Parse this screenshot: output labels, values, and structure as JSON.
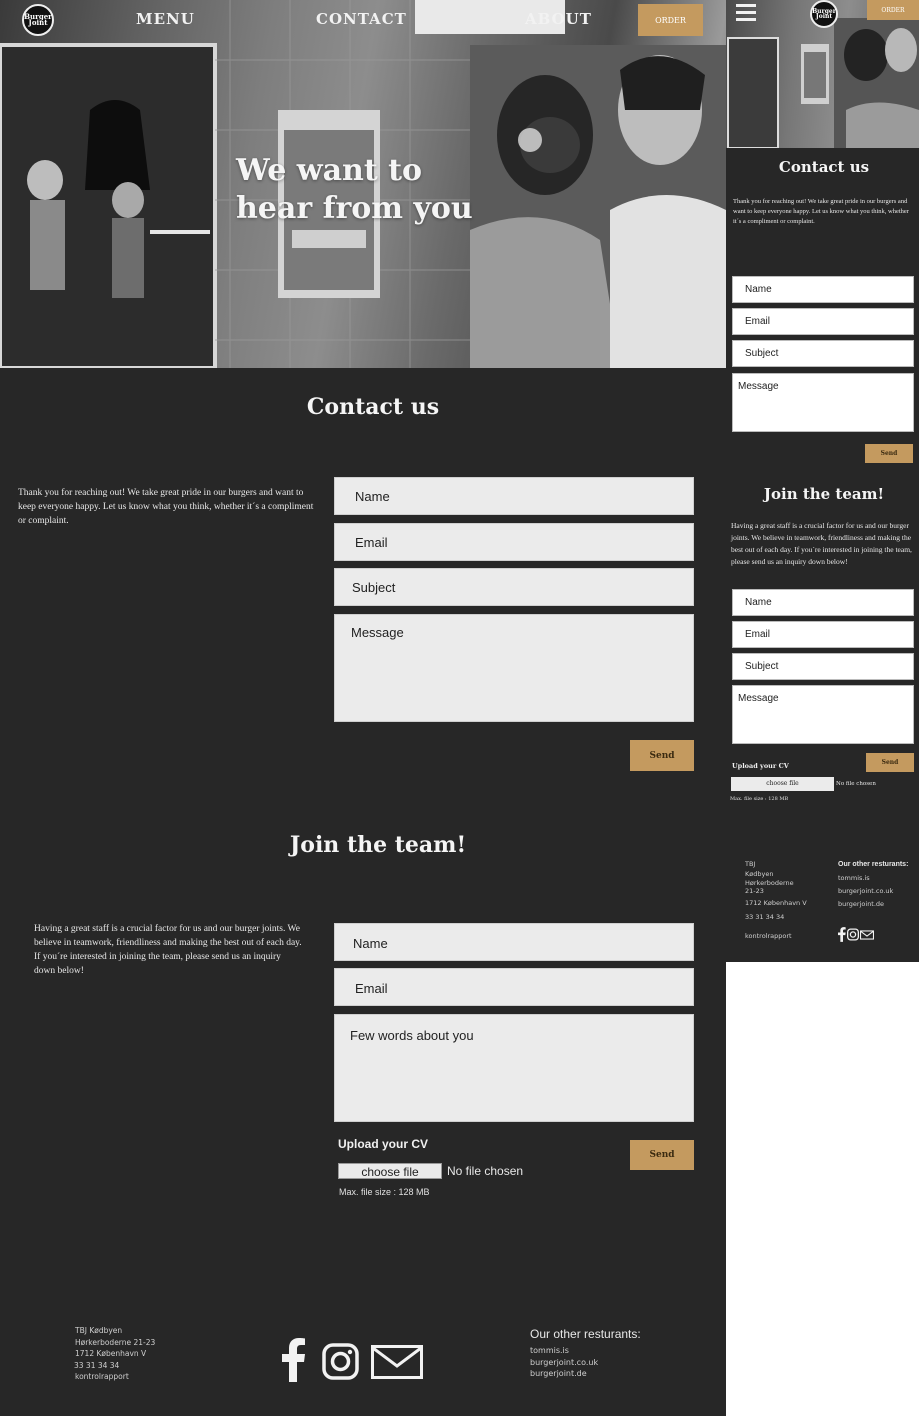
{
  "desktop": {
    "logo_text": "Burger Joint",
    "nav": {
      "menu": "MENU",
      "contact": "CONTACT",
      "about": "ABOUT",
      "order": "ORDER"
    },
    "hero_title_line1": "We want to",
    "hero_title_line2": "hear from you",
    "contact": {
      "title": "Contact us",
      "intro": "Thank you for reaching out! We take great pride in our burgers and want to keep everyone happy. Let us know what you think, whether it´s a compliment or complaint.",
      "name_placeholder": "Name",
      "email_placeholder": "Email",
      "subject_placeholder": "Subject",
      "message_placeholder": "Message",
      "send": "Send"
    },
    "join": {
      "title": "Join the team!",
      "intro": "Having a great staff is a crucial factor for us and our burger joints. We believe in teamwork, friendliness and making the best out of each day. If you´re interested in joining the team, please send us an inquiry down below!",
      "name_placeholder": "Name",
      "email_placeholder": "Email",
      "about_placeholder": "Few words about you",
      "upload_label": "Upload your CV",
      "choose_file": "choose file",
      "no_file": "No file chosen",
      "max_size": "Max. file size : 128 MB",
      "send": "Send"
    },
    "footer": {
      "address_line1": "TBJ Kødbyen",
      "address_line2": "Hørkerboderne 21-23",
      "address_line3": "1712 København V",
      "phone": "33 31 34 34",
      "kontrol": "kontrolrapport",
      "other_title": "Our other resturants:",
      "other_1": "tommis.is",
      "other_2": "burgerjoint.co.uk",
      "other_3": "burgerjoint.de"
    }
  },
  "mobile": {
    "logo_text": "Burger Joint",
    "order": "ORDER",
    "contact": {
      "title": "Contact us",
      "intro": "Thank you for reaching out! We take great pride in our burgers and want to keep everyone happy. Let us know what you think, whether it´s a compliment or complaint.",
      "name": "Name",
      "email": "Email",
      "subject": "Subject",
      "message": "Message",
      "send": "Send"
    },
    "join": {
      "title": "Join the team!",
      "intro": "Having a great staff is a crucial factor for us and our burger joints. We believe in teamwork, friendliness and making the best out of each day. If you´re interested in joining the team, please send us an inquiry down below!",
      "name": "Name",
      "email": "Email",
      "subject": "Subject",
      "message": "Message",
      "send": "Send",
      "upload_label": "Upload your CV",
      "choose_file": "choose file",
      "no_file": "No file chosen",
      "max_size": "Max. file size : 128 MB"
    },
    "footer": {
      "address_line1": "TBJ",
      "address_line2": "Kødbyen",
      "address_line3": "Hørkerboderne",
      "address_line4": "21-23",
      "address_line5": "1712 København V",
      "phone": "33 31 34 34",
      "kontrol": "kontrolrapport",
      "other_title": "Our other resturants:",
      "other_1": "tommis.is",
      "other_2": "burgerjoint.co.uk",
      "other_3": "burgerjoint.de"
    }
  },
  "colors": {
    "background": "#272727",
    "accent": "#c49a5f",
    "field": "#ebebeb"
  }
}
